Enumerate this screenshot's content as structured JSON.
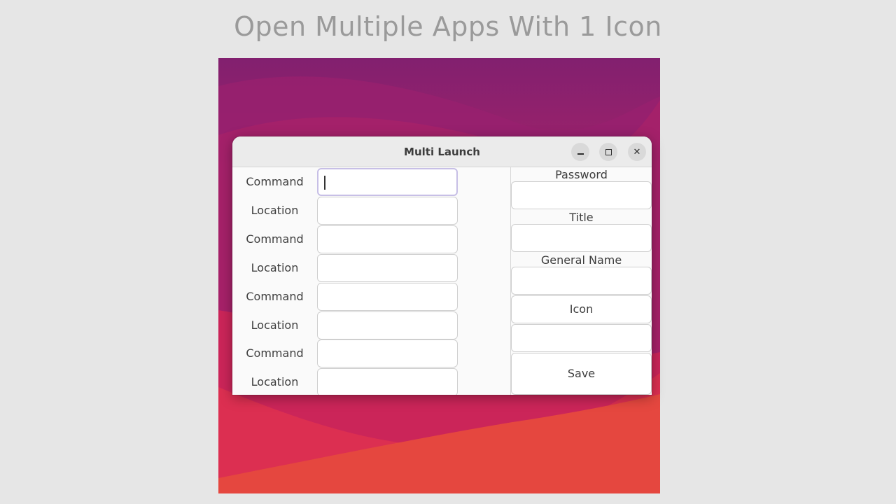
{
  "page_heading": "Open Multiple Apps With 1 Icon",
  "window": {
    "title": "Multi Launch",
    "minimize_icon": "minimize-icon",
    "maximize_icon": "maximize-icon",
    "close_icon": "close-icon"
  },
  "left_rows": [
    {
      "label": "Command",
      "value": "",
      "focused": true
    },
    {
      "label": "Location",
      "value": ""
    },
    {
      "label": "Command",
      "value": ""
    },
    {
      "label": "Location",
      "value": ""
    },
    {
      "label": "Command",
      "value": ""
    },
    {
      "label": "Location",
      "value": ""
    },
    {
      "label": "Command",
      "value": ""
    },
    {
      "label": "Location",
      "value": ""
    }
  ],
  "right_panel": {
    "password_label": "Password",
    "password_value": "",
    "title_label": "Title",
    "title_value": "",
    "general_name_label": "General Name",
    "general_name_value": "",
    "icon_button": "Icon",
    "icon_path_value": "",
    "save_button": "Save"
  },
  "colors": {
    "wallpaper_top": "#7e1f6e",
    "wallpaper_bottom": "#e5473f",
    "focus_ring": "#c7bfe6"
  }
}
